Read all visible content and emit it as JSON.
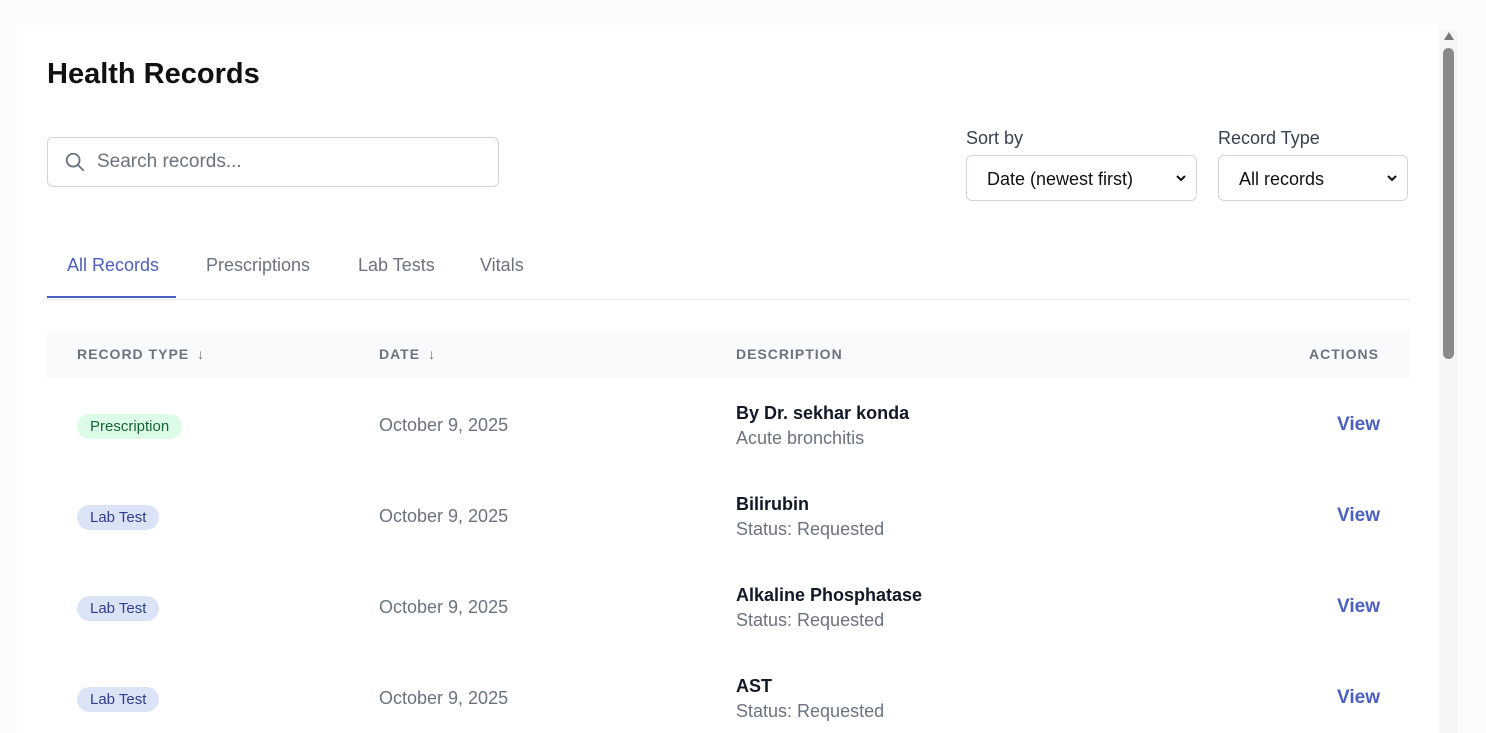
{
  "page": {
    "title": "Health Records"
  },
  "search": {
    "placeholder": "Search records...",
    "value": "",
    "icon": "search-icon"
  },
  "filters": {
    "sort_label": "Sort by",
    "sort_value": "Date (newest first)",
    "type_label": "Record Type",
    "type_value": "All records"
  },
  "tabs": [
    {
      "label": "All Records",
      "active": true
    },
    {
      "label": "Prescriptions",
      "active": false
    },
    {
      "label": "Lab Tests",
      "active": false
    },
    {
      "label": "Vitals",
      "active": false
    }
  ],
  "table": {
    "headers": {
      "record_type": "RECORD TYPE",
      "record_type_sort": "↓",
      "date": "DATE",
      "date_sort": "↓",
      "description": "DESCRIPTION",
      "actions": "ACTIONS"
    },
    "rows": [
      {
        "type": "Prescription",
        "date": "October 9, 2025",
        "title": "By Dr. sekhar konda",
        "subtitle": "Acute bronchitis",
        "action": "View"
      },
      {
        "type": "Lab Test",
        "date": "October 9, 2025",
        "title": "Bilirubin",
        "subtitle": "Status: Requested",
        "action": "View"
      },
      {
        "type": "Lab Test",
        "date": "October 9, 2025",
        "title": "Alkaline Phosphatase",
        "subtitle": "Status: Requested",
        "action": "View"
      },
      {
        "type": "Lab Test",
        "date": "October 9, 2025",
        "title": "AST",
        "subtitle": "Status: Requested",
        "action": "View"
      }
    ]
  },
  "colors": {
    "accent": "#4a5fc1",
    "prescription_badge_bg": "#dcfce7",
    "prescription_badge_text": "#166534",
    "lab_badge_bg": "#dbe4f7",
    "lab_badge_text": "#2f3f8f"
  }
}
